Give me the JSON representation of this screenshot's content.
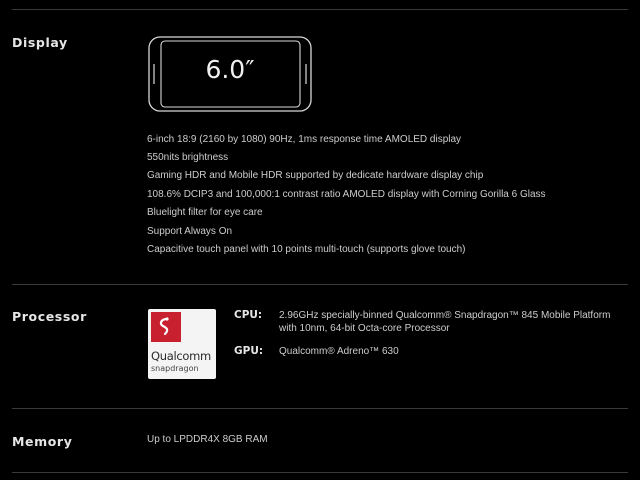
{
  "display": {
    "title": "Display",
    "screen_size": "6.0″",
    "specs": [
      "6-inch 18:9 (2160 by 1080) 90Hz, 1ms response time AMOLED display",
      "550nits brightness",
      "Gaming HDR and Mobile HDR supported by dedicate hardware display chip",
      "108.6% DCIP3 and 100,000:1 contrast ratio AMOLED display with Corning Gorilla 6 Glass",
      "Bluelight filter for eye care",
      "Support Always On",
      "Capacitive touch panel with 10 points multi-touch (supports glove touch)"
    ]
  },
  "processor": {
    "title": "Processor",
    "logo": {
      "name": "Qualcomm",
      "sub": "snapdragon",
      "brand_color": "#c8202f"
    },
    "cpu": {
      "label": "CPU:",
      "line1": "2.96GHz specially-binned Qualcomm® Snapdragon™ 845 Mobile Platform",
      "line2": "with 10nm, 64-bit Octa-core Processor"
    },
    "gpu": {
      "label": "GPU:",
      "value": "Qualcomm® Adreno™ 630"
    }
  },
  "memory": {
    "title": "Memory",
    "value": "Up to LPDDR4X 8GB RAM"
  },
  "colors": {
    "background": "#000000",
    "divider": "#3a3a3a",
    "text": "#cdcdcd",
    "heading": "#e6e6e6"
  }
}
